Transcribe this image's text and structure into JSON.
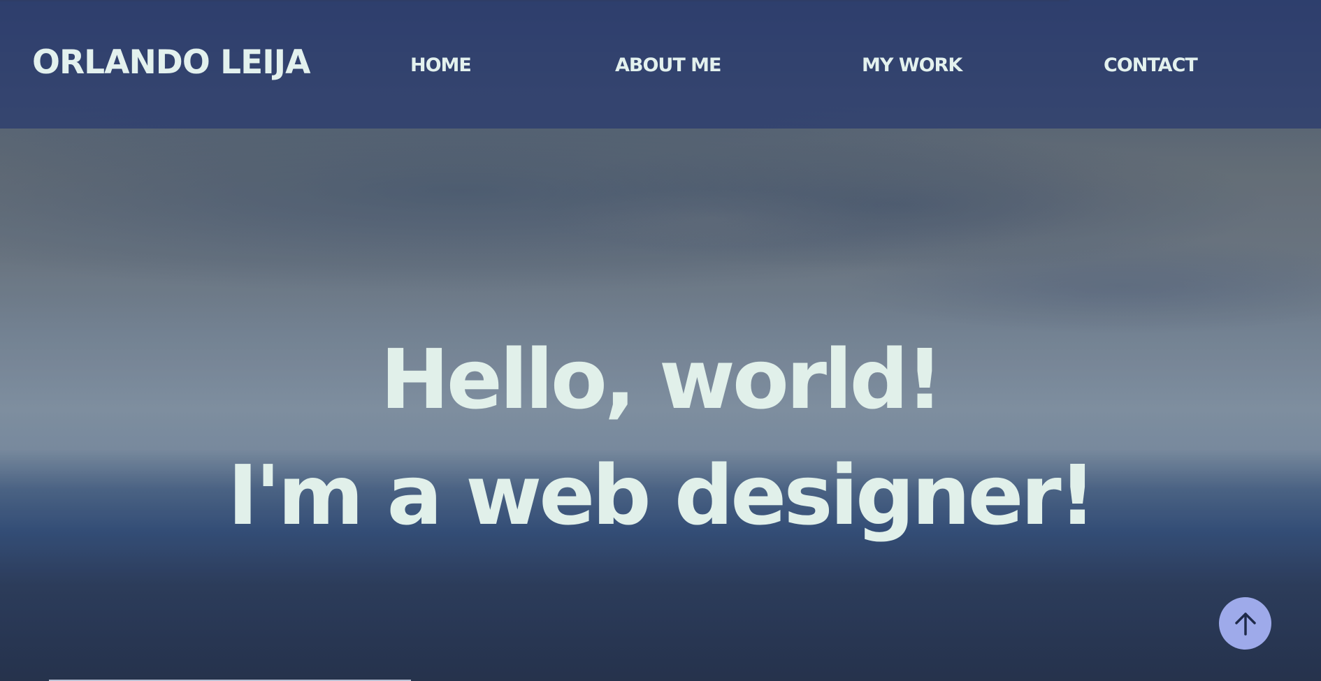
{
  "header": {
    "brand": "ORLANDO LEIJA",
    "nav": [
      {
        "label": "HOME"
      },
      {
        "label": "ABOUT ME"
      },
      {
        "label": "MY WORK"
      },
      {
        "label": "CONTACT"
      }
    ]
  },
  "hero": {
    "line1": "Hello, world!",
    "line2": "I'm a web designer!"
  },
  "scroll_top": {
    "icon": "arrow-up-icon"
  },
  "colors": {
    "navbar": "#2c3c6e",
    "text": "#e3f1ee",
    "scroll_button": "#9eaaea",
    "scroll_icon": "#1f2a4a"
  }
}
